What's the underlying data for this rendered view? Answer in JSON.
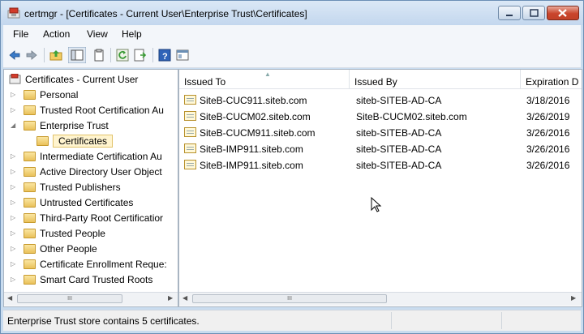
{
  "window": {
    "title": "certmgr - [Certificates - Current User\\Enterprise Trust\\Certificates]"
  },
  "menu": [
    "File",
    "Action",
    "View",
    "Help"
  ],
  "toolbar": {
    "icons": [
      "back-arrow-icon",
      "forward-arrow-icon",
      "up-folder-icon",
      "show-hide-tree-icon",
      "copy-icon",
      "refresh-icon",
      "export-list-icon",
      "help-icon",
      "properties-icon"
    ]
  },
  "tree": {
    "root": "Certificates - Current User",
    "items": [
      {
        "label": "Personal",
        "expander": "▷"
      },
      {
        "label": "Trusted Root Certification Au",
        "expander": "▷"
      },
      {
        "label": "Enterprise Trust",
        "expander": "◢"
      },
      {
        "label": "Certificates",
        "expander": ""
      },
      {
        "label": "Intermediate Certification Au",
        "expander": "▷"
      },
      {
        "label": "Active Directory User Object",
        "expander": "▷"
      },
      {
        "label": "Trusted Publishers",
        "expander": "▷"
      },
      {
        "label": "Untrusted Certificates",
        "expander": "▷"
      },
      {
        "label": "Third-Party Root Certificatior",
        "expander": "▷"
      },
      {
        "label": "Trusted People",
        "expander": "▷"
      },
      {
        "label": "Other People",
        "expander": "▷"
      },
      {
        "label": "Certificate Enrollment Reque:",
        "expander": "▷"
      },
      {
        "label": "Smart Card Trusted Roots",
        "expander": "▷"
      }
    ],
    "scroll_thumb": "III"
  },
  "list": {
    "columns": [
      "Issued To",
      "Issued By",
      "Expiration D"
    ],
    "rows": [
      {
        "issued_to": "SiteB-CUC911.siteb.com",
        "issued_by": "siteb-SITEB-AD-CA",
        "expiration": "3/18/2016"
      },
      {
        "issued_to": "SiteB-CUCM02.siteb.com",
        "issued_by": "SiteB-CUCM02.siteb.com",
        "expiration": "3/26/2019"
      },
      {
        "issued_to": "SiteB-CUCM911.siteb.com",
        "issued_by": "siteb-SITEB-AD-CA",
        "expiration": "3/26/2016"
      },
      {
        "issued_to": "SiteB-IMP911.siteb.com",
        "issued_by": "siteb-SITEB-AD-CA",
        "expiration": "3/26/2016"
      },
      {
        "issued_to": "SiteB-IMP911.siteb.com",
        "issued_by": "siteb-SITEB-AD-CA",
        "expiration": "3/26/2016"
      }
    ],
    "scroll_thumb": "III"
  },
  "status": {
    "text": "Enterprise Trust store contains 5 certificates."
  },
  "colors": {
    "title_bar": "#c3d7ee",
    "close_button": "#c9452c",
    "selection": "#fff4cf",
    "folder": "#e9c15a"
  }
}
